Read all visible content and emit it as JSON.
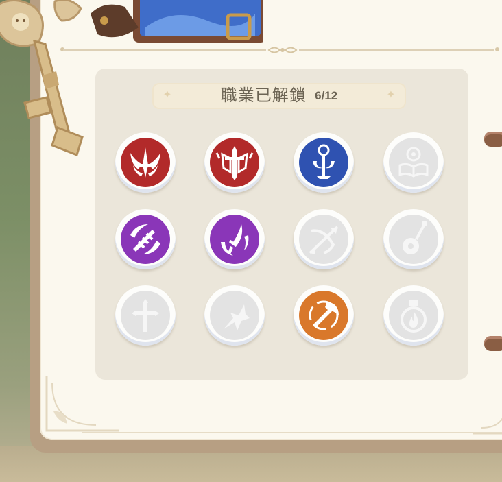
{
  "header": {
    "title": "職業已解鎖",
    "count": "6/12"
  },
  "jobs": [
    {
      "icon": "crimson-sword-wings-icon",
      "unlocked": true,
      "color": "#b22a2a"
    },
    {
      "icon": "crimson-cross-shield-icon",
      "unlocked": true,
      "color": "#b22a2a"
    },
    {
      "icon": "blue-holy-staff-icon",
      "unlocked": true,
      "color": "#2f52b1"
    },
    {
      "icon": "book-lamp-icon",
      "unlocked": false,
      "color": "#e3e3e3"
    },
    {
      "icon": "purple-twin-blades-icon",
      "unlocked": true,
      "color": "#8a36b8"
    },
    {
      "icon": "purple-dagger-icon",
      "unlocked": true,
      "color": "#8a36b8"
    },
    {
      "icon": "bow-arrow-icon",
      "unlocked": false,
      "color": "#e3e3e3"
    },
    {
      "icon": "lute-icon",
      "unlocked": false,
      "color": "#e3e3e3"
    },
    {
      "icon": "holy-cross-icon",
      "unlocked": false,
      "color": "#e3e3e3"
    },
    {
      "icon": "beast-claw-icon",
      "unlocked": false,
      "color": "#e3e3e3"
    },
    {
      "icon": "orange-battle-axe-icon",
      "unlocked": true,
      "color": "#d9782b"
    },
    {
      "icon": "fire-flask-icon",
      "unlocked": false,
      "color": "#e3e3e3"
    }
  ],
  "colors": {
    "locked_glyph": "#f6f6f6",
    "unlocked_glyph": "#ffffff",
    "panel": "#ebe6da",
    "page": "#fbf8ee"
  }
}
